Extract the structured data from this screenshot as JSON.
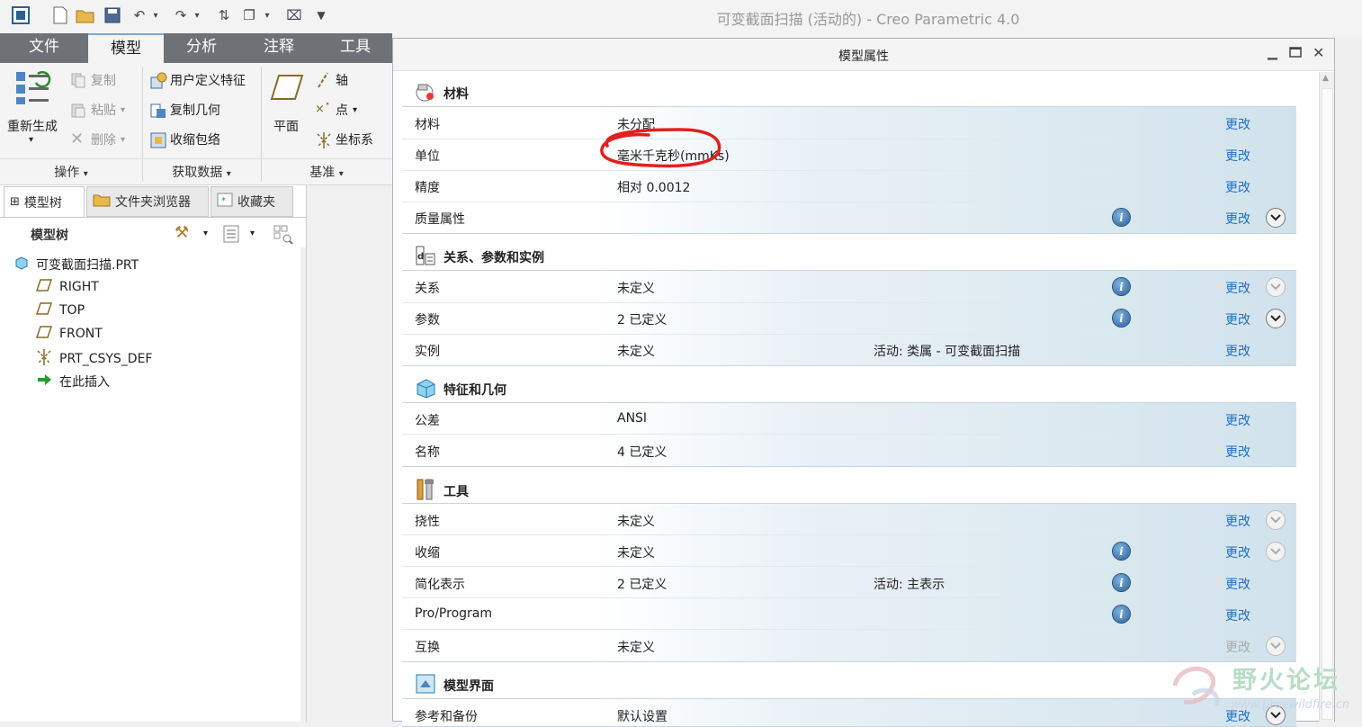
{
  "window": {
    "title": "可变截面扫描 (活动的) - Creo Parametric 4.0"
  },
  "tabs": [
    {
      "label": "文件"
    },
    {
      "label": "模型"
    },
    {
      "label": "分析"
    },
    {
      "label": "注释"
    },
    {
      "label": "工具"
    }
  ],
  "ribbon": {
    "regenerate": "重新生成",
    "copy": "复制",
    "paste": "粘贴",
    "delete": "删除",
    "udf": "用户定义特征",
    "copy_geom": "复制几何",
    "shrinkwrap": "收缩包络",
    "plane": "平面",
    "axis": "轴",
    "point": "点",
    "csys": "坐标系",
    "group_ops": "操作",
    "group_getdata": "获取数据",
    "group_datum": "基准",
    "dropdown": "▾"
  },
  "left_panel": {
    "tabs": [
      "模型树",
      "文件夹浏览器",
      "收藏夹"
    ],
    "header": "模型树",
    "tree": [
      {
        "label": "可变截面扫描.PRT",
        "icon": "part-icon"
      },
      {
        "label": "RIGHT",
        "icon": "datum-plane-icon"
      },
      {
        "label": "TOP",
        "icon": "datum-plane-icon"
      },
      {
        "label": "FRONT",
        "icon": "datum-plane-icon"
      },
      {
        "label": "PRT_CSYS_DEF",
        "icon": "csys-icon"
      },
      {
        "label": "在此插入",
        "icon": "insert-arrow-icon"
      }
    ]
  },
  "dialog": {
    "title": "模型属性",
    "change_label": "更改",
    "sections": {
      "material": {
        "title": "材料",
        "rows": [
          {
            "label": "材料",
            "value": "未分配"
          },
          {
            "label": "单位",
            "value": "毫米千克秒(mmKs)"
          },
          {
            "label": "精度",
            "value": "相对 0.0012"
          },
          {
            "label": "质量属性",
            "value": ""
          }
        ]
      },
      "relations": {
        "title": "关系、参数和实例",
        "rows": [
          {
            "label": "关系",
            "value": "未定义"
          },
          {
            "label": "参数",
            "value": "2 已定义"
          },
          {
            "label": "实例",
            "value": "未定义",
            "extra": "活动: 类属 - 可变截面扫描"
          }
        ]
      },
      "features": {
        "title": "特征和几何",
        "rows": [
          {
            "label": "公差",
            "value": "ANSI"
          },
          {
            "label": "名称",
            "value": "4 已定义"
          }
        ]
      },
      "tools": {
        "title": "工具",
        "rows": [
          {
            "label": "挠性",
            "value": "未定义"
          },
          {
            "label": "收缩",
            "value": "未定义"
          },
          {
            "label": "简化表示",
            "value": "2 已定义",
            "extra": "活动: 主表示"
          },
          {
            "label": "Pro/Program",
            "value": ""
          },
          {
            "label": "互换",
            "value": "未定义"
          }
        ]
      },
      "interface": {
        "title": "模型界面",
        "rows": [
          {
            "label": "参考和备份",
            "value": "默认设置"
          }
        ]
      }
    }
  },
  "watermark": {
    "text": "野火论坛",
    "url": "www.proewildfire.cn"
  },
  "colors": {
    "accent": "#1d6fc4",
    "tabbar": "#6e7176",
    "annotation": "#e0201e"
  }
}
